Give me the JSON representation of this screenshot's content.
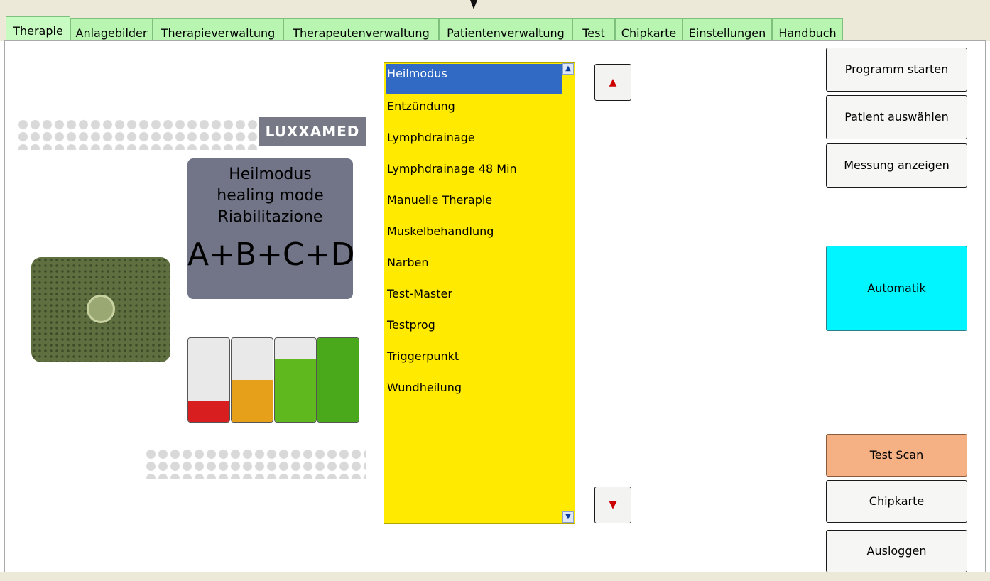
{
  "tabs": [
    {
      "label": "Therapie",
      "active": true
    },
    {
      "label": "Anlagebilder"
    },
    {
      "label": "Therapieverwaltung"
    },
    {
      "label": "Therapeutenverwaltung"
    },
    {
      "label": "Patientenverwaltung"
    },
    {
      "label": "Test"
    },
    {
      "label": "Chipkarte"
    },
    {
      "label": "Einstellungen"
    },
    {
      "label": "Handbuch"
    }
  ],
  "illustration": {
    "logo": "LUXXAMED",
    "mode_lines": [
      "Heilmodus",
      "healing mode",
      "Riabilitazione",
      "A+B+C+D"
    ],
    "battery_levels": [
      0.25,
      0.5,
      0.75,
      1.0
    ]
  },
  "program_list": {
    "items": [
      "Heilmodus",
      "Entzündung",
      "Lymphdrainage",
      "Lymphdrainage 48 Min",
      "Manuelle Therapie",
      "Muskelbehandlung",
      "Narben",
      "Test-Master",
      "Testprog",
      "Triggerpunkt",
      "Wundheilung"
    ],
    "selected": "Heilmodus"
  },
  "buttons": {
    "programm_starten": "Programm starten",
    "patient_auswaehlen": "Patient auswählen",
    "messung_anzeigen": "Messung anzeigen",
    "automatik": "Automatik",
    "test_scan": "Test Scan",
    "chipkarte": "Chipkarte",
    "ausloggen": "Ausloggen"
  },
  "colors": {
    "tab": "#b7f5b0",
    "list_bg": "#ffea00",
    "selection": "#316ac5",
    "automatik": "#00f5ff",
    "test_scan": "#f5b083"
  }
}
